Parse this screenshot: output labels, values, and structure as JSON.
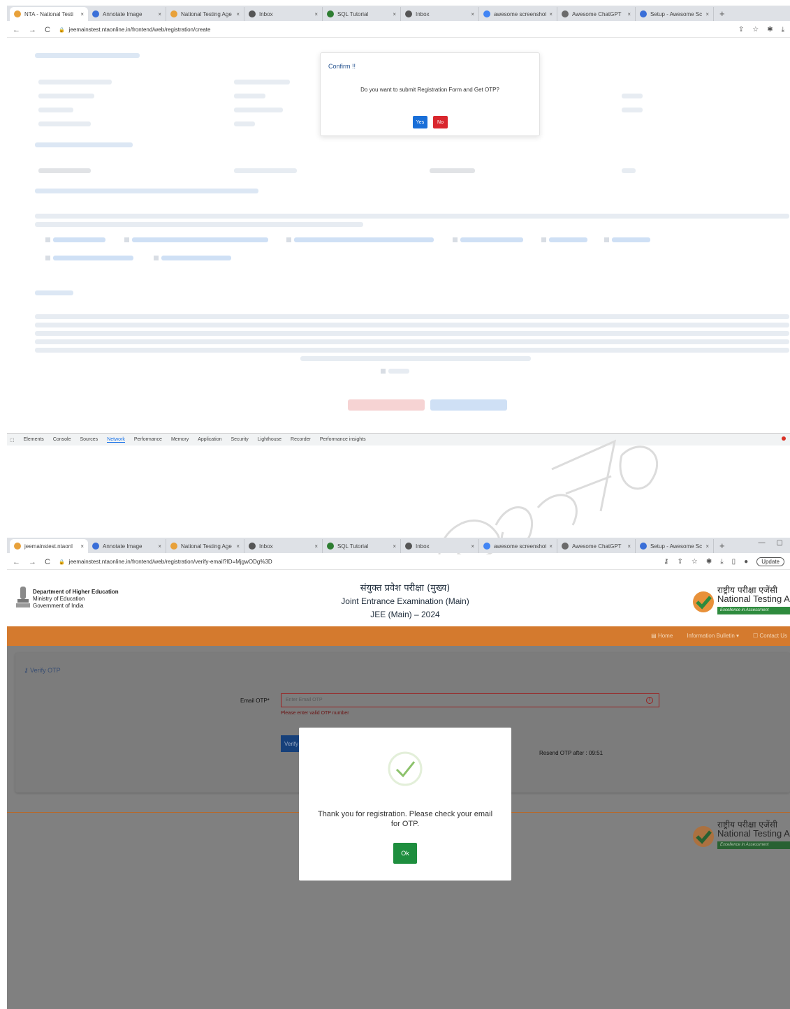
{
  "screenshot1": {
    "tabs": [
      {
        "title": "NTA - National Testi",
        "fav": "#e8a13a"
      },
      {
        "title": "Annotate Image",
        "fav": "#3a6fd8"
      },
      {
        "title": "National Testing Age",
        "fav": "#e8a13a"
      },
      {
        "title": "Inbox",
        "fav": "#555555"
      },
      {
        "title": "SQL Tutorial",
        "fav": "#2e7d32"
      },
      {
        "title": "Inbox",
        "fav": "#555555"
      },
      {
        "title": "awesome screenshot",
        "fav": "#4285f4"
      },
      {
        "title": "Awesome ChatGPT",
        "fav": "#6b6b6b"
      },
      {
        "title": "Setup - Awesome Sc",
        "fav": "#3a6fd8"
      }
    ],
    "url": "jeemainstest.ntaonline.in/frontend/web/registration/create",
    "confirm": {
      "title": "Confirm !!",
      "message": "Do you want to submit Registration Form and Get OTP?",
      "yes": "Yes",
      "no": "No"
    },
    "devtools": [
      "Elements",
      "Console",
      "Sources",
      "Network",
      "Performance",
      "Memory",
      "Application",
      "Security",
      "Lighthouse",
      "Recorder",
      "Performance insights"
    ]
  },
  "screenshot2": {
    "tabs": [
      {
        "title": "jeemainstest.ntaonl",
        "fav": "#e8a13a"
      },
      {
        "title": "Annotate Image",
        "fav": "#3a6fd8"
      },
      {
        "title": "National Testing Age",
        "fav": "#e8a13a"
      },
      {
        "title": "Inbox",
        "fav": "#555555"
      },
      {
        "title": "SQL Tutorial",
        "fav": "#2e7d32"
      },
      {
        "title": "Inbox",
        "fav": "#555555"
      },
      {
        "title": "awesome screenshot",
        "fav": "#4285f4"
      },
      {
        "title": "Awesome ChatGPT",
        "fav": "#6b6b6b"
      },
      {
        "title": "Setup - Awesome Sc",
        "fav": "#3a6fd8"
      }
    ],
    "url": "jeemainstest.ntaonline.in/frontend/web/registration/verify-email?ID=MjgwODg%3D",
    "update_label": "Update",
    "dept": {
      "line1": "Department of Higher Education",
      "line2": "Ministry of Education",
      "line3": "Government of India"
    },
    "title_hi": "संयुक्त प्रवेश परीक्षा (मुख्य)",
    "title_en": "Joint Entrance Examination (Main)",
    "title_year": "JEE (Main) – 2024",
    "nta": {
      "hindi": "राष्ट्रीय परीक्षा एजेंसी",
      "english": "National Testing Agency",
      "tagline": "Excellence in Assessment"
    },
    "menu": [
      "Home",
      "Information Bulletin",
      "Contact Us"
    ],
    "verify_heading": "Verify OTP",
    "otp_label": "Email OTP*",
    "otp_placeholder": "Enter Email OTP",
    "otp_error": "Please enter valid OTP number",
    "verify_button": "Verify",
    "resend": "Resend OTP after : 09:51",
    "modal": {
      "message": "Thank you for registration. Please check your email for OTP.",
      "ok": "Ok"
    }
  },
  "colors": {
    "nta_orange": "#d47a2e",
    "nta_green": "#2e8b3e",
    "yes_blue": "#1a6fd8",
    "no_red": "#d9272e",
    "ok_green": "#1e8e3e"
  }
}
